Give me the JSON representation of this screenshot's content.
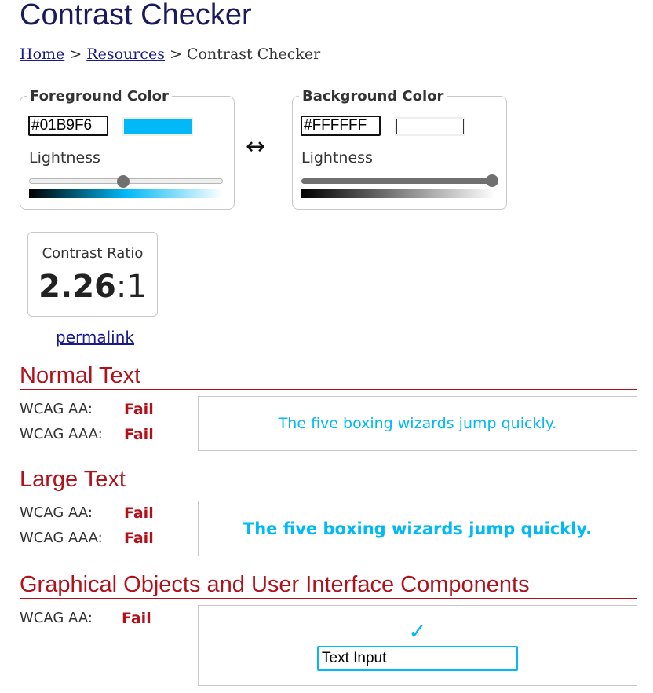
{
  "page": {
    "title": "Contrast Checker"
  },
  "breadcrumb": {
    "home": "Home",
    "separator": ">",
    "resources": "Resources",
    "current": "Contrast Checker"
  },
  "foreground": {
    "legend": "Foreground Color",
    "hex": "#01B9F6",
    "color": "#01B9F6",
    "lightness_label": "Lightness",
    "lightness_value": 0.48
  },
  "background": {
    "legend": "Background Color",
    "hex": "#FFFFFF",
    "color": "#FFFFFF",
    "lightness_label": "Lightness",
    "lightness_value": 1.0
  },
  "swap_icon": "↔",
  "contrast": {
    "label": "Contrast Ratio",
    "ratio_bold": "2.26",
    "ratio_suffix": ":1",
    "permalink": "permalink"
  },
  "normal_text": {
    "heading": "Normal Text",
    "aa_label": "WCAG AA:",
    "aa_result": "Fail",
    "aaa_label": "WCAG AAA:",
    "aaa_result": "Fail",
    "sample": "The five boxing wizards jump quickly."
  },
  "large_text": {
    "heading": "Large Text",
    "aa_label": "WCAG AA:",
    "aa_result": "Fail",
    "aaa_label": "WCAG AAA:",
    "aaa_result": "Fail",
    "sample": "The five boxing wizards jump quickly."
  },
  "graphical": {
    "heading": "Graphical Objects and User Interface Components",
    "aa_label": "WCAG AA:",
    "aa_result": "Fail",
    "check_icon": "✓",
    "input_value": "Text Input"
  },
  "colors": {
    "title": "#1a1a5e",
    "link": "#1a1a8c",
    "heading_red": "#b0121b",
    "fail_red": "#b0121b"
  }
}
